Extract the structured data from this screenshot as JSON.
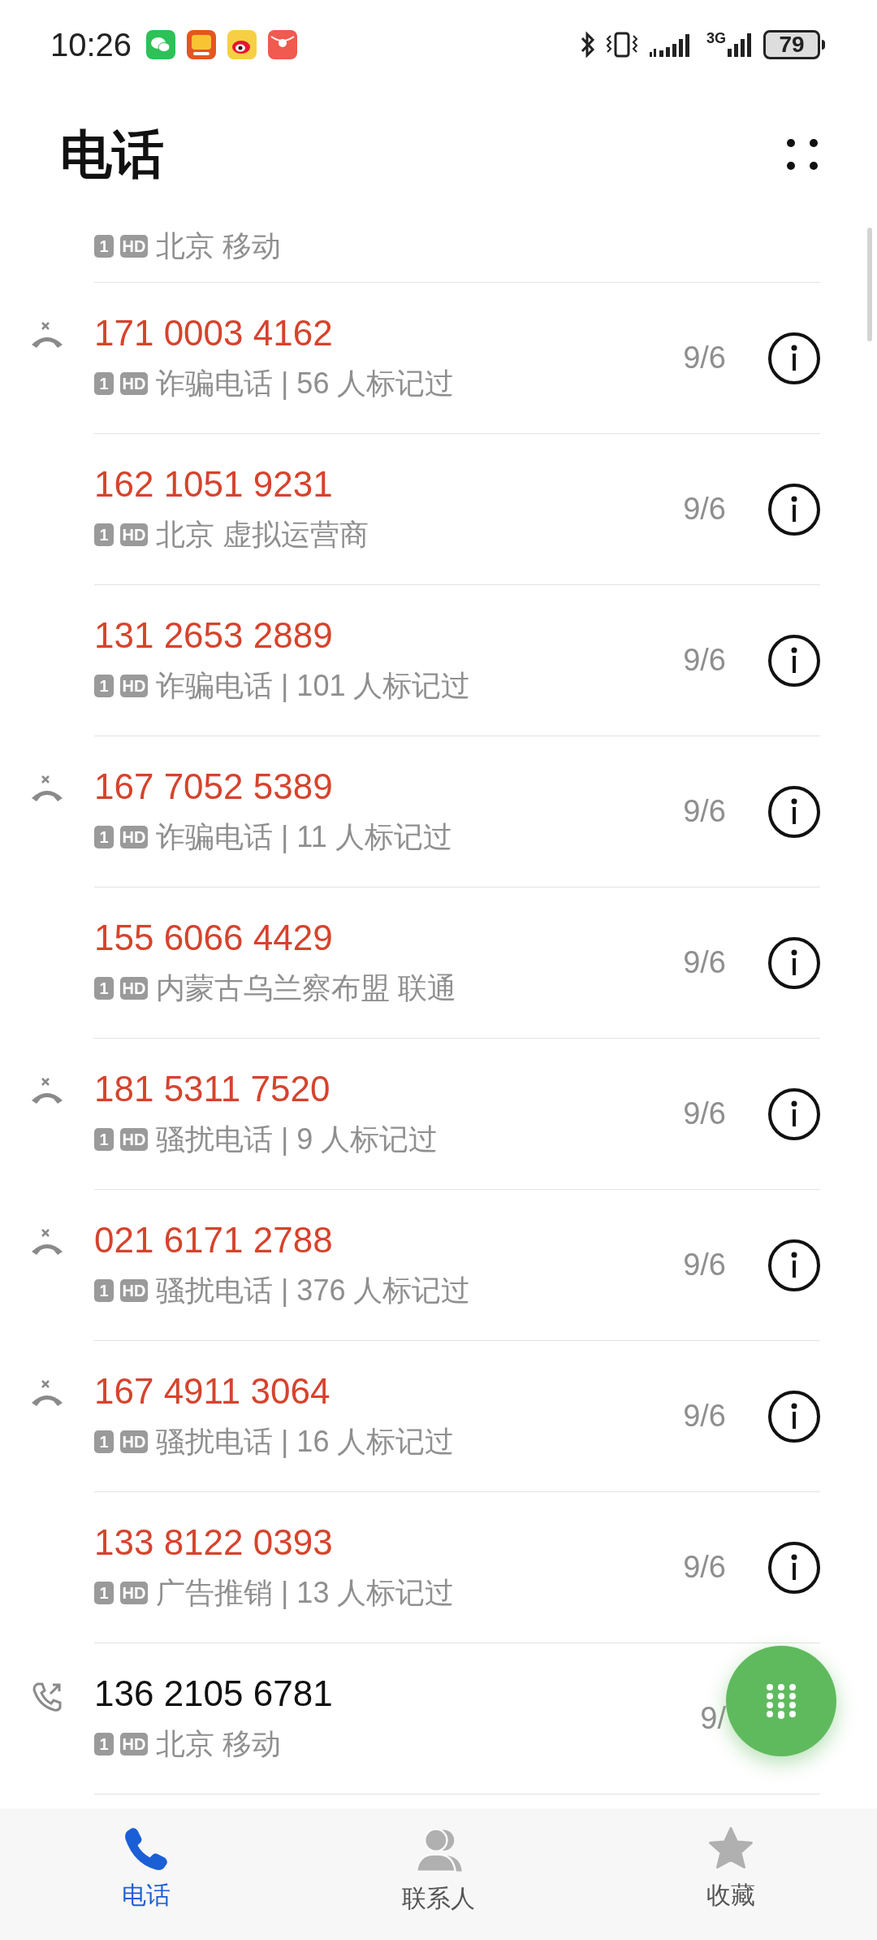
{
  "status_bar": {
    "time": "10:26",
    "network": "3G",
    "battery": "79"
  },
  "title": "电话",
  "partial_row": {
    "badges": [
      "1",
      "HD"
    ],
    "subtitle": "北京 移动"
  },
  "calls": [
    {
      "kind": "missed",
      "marked": true,
      "number": "171 0003 4162",
      "badges": [
        "1",
        "HD"
      ],
      "subtitle": "诈骗电话 | 56 人标记过",
      "date": "9/6"
    },
    {
      "kind": "plain",
      "marked": true,
      "number": "162 1051 9231",
      "badges": [
        "1",
        "HD"
      ],
      "subtitle": "北京 虚拟运营商",
      "date": "9/6"
    },
    {
      "kind": "plain",
      "marked": true,
      "number": "131 2653 2889",
      "badges": [
        "1",
        "HD"
      ],
      "subtitle": "诈骗电话 | 101 人标记过",
      "date": "9/6"
    },
    {
      "kind": "missed",
      "marked": true,
      "number": "167 7052 5389",
      "badges": [
        "1",
        "HD"
      ],
      "subtitle": "诈骗电话 | 11 人标记过",
      "date": "9/6"
    },
    {
      "kind": "plain",
      "marked": true,
      "number": "155 6066 4429",
      "badges": [
        "1",
        "HD"
      ],
      "subtitle": "内蒙古乌兰察布盟 联通",
      "date": "9/6"
    },
    {
      "kind": "missed",
      "marked": true,
      "number": "181 5311 7520",
      "badges": [
        "1",
        "HD"
      ],
      "subtitle": "骚扰电话 | 9 人标记过",
      "date": "9/6"
    },
    {
      "kind": "missed",
      "marked": true,
      "number": "021 6171 2788",
      "badges": [
        "1",
        "HD"
      ],
      "subtitle": "骚扰电话 | 376 人标记过",
      "date": "9/6"
    },
    {
      "kind": "missed",
      "marked": true,
      "number": "167 4911 3064",
      "badges": [
        "1",
        "HD"
      ],
      "subtitle": "骚扰电话 | 16 人标记过",
      "date": "9/6"
    },
    {
      "kind": "plain",
      "marked": true,
      "number": "133 8122 0393",
      "badges": [
        "1",
        "HD"
      ],
      "subtitle": "广告推销 | 13 人标记过",
      "date": "9/6"
    },
    {
      "kind": "outgoing",
      "marked": false,
      "number": "136 2105 6781",
      "badges": [
        "1",
        "HD"
      ],
      "subtitle": "北京 移动",
      "date": "9/"
    }
  ],
  "tabs": [
    {
      "kind": "phone",
      "label": "电话",
      "selected": true
    },
    {
      "kind": "contacts",
      "label": "联系人",
      "selected": false
    },
    {
      "kind": "favorites",
      "label": "收藏",
      "selected": false
    }
  ]
}
